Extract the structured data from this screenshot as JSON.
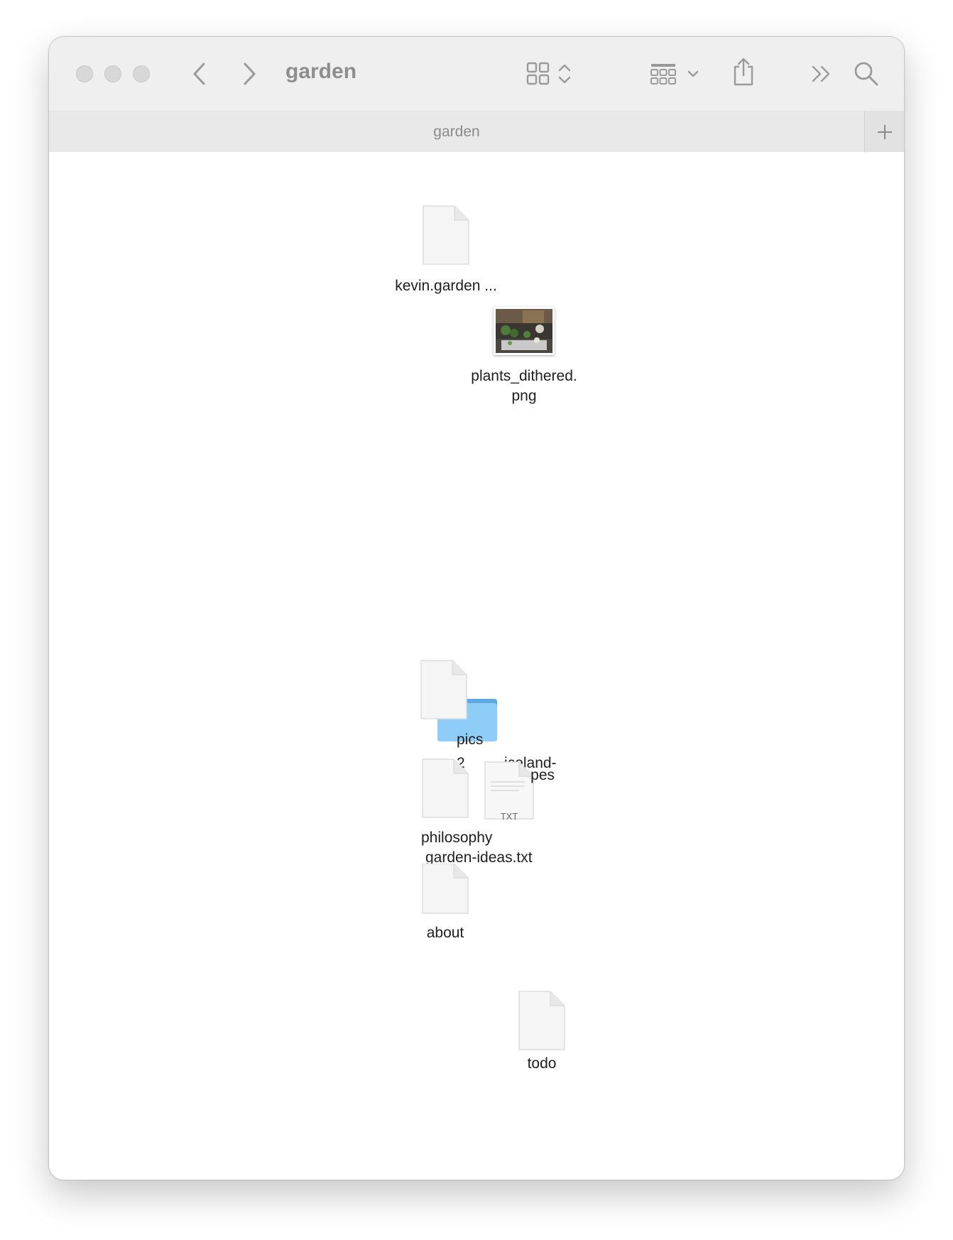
{
  "window": {
    "title": "garden",
    "tab_title": "garden"
  },
  "toolbar": {
    "buttons": [
      {
        "name": "close-button"
      },
      {
        "name": "minimize-button"
      },
      {
        "name": "zoom-button"
      },
      {
        "name": "back-icon"
      },
      {
        "name": "forward-icon"
      },
      {
        "name": "icon-view-icon"
      },
      {
        "name": "group-by-icon"
      },
      {
        "name": "share-icon"
      },
      {
        "name": "more-icon"
      },
      {
        "name": "search-icon"
      }
    ]
  },
  "files": [
    {
      "name": "kevin.garden ...",
      "kind": "document"
    },
    {
      "name": "plants_dithered.",
      "name_line2": "png",
      "kind": "image"
    },
    {
      "name": "pics",
      "kind": "folder"
    },
    {
      "name": "2",
      "name_mid": "iceland-",
      "name_line2": "pes",
      "kind": "document"
    },
    {
      "name": "philosophy",
      "kind": "document"
    },
    {
      "name": "garden-ideas.txt",
      "kind": "text",
      "badge": "TXT"
    },
    {
      "name": "about",
      "kind": "document"
    },
    {
      "name": "todo",
      "kind": "document"
    }
  ],
  "colors": {
    "toolbar_bg": "#efefef",
    "folder_blue": "#8ecdf7",
    "icon_gray": "#9a9a9a"
  }
}
